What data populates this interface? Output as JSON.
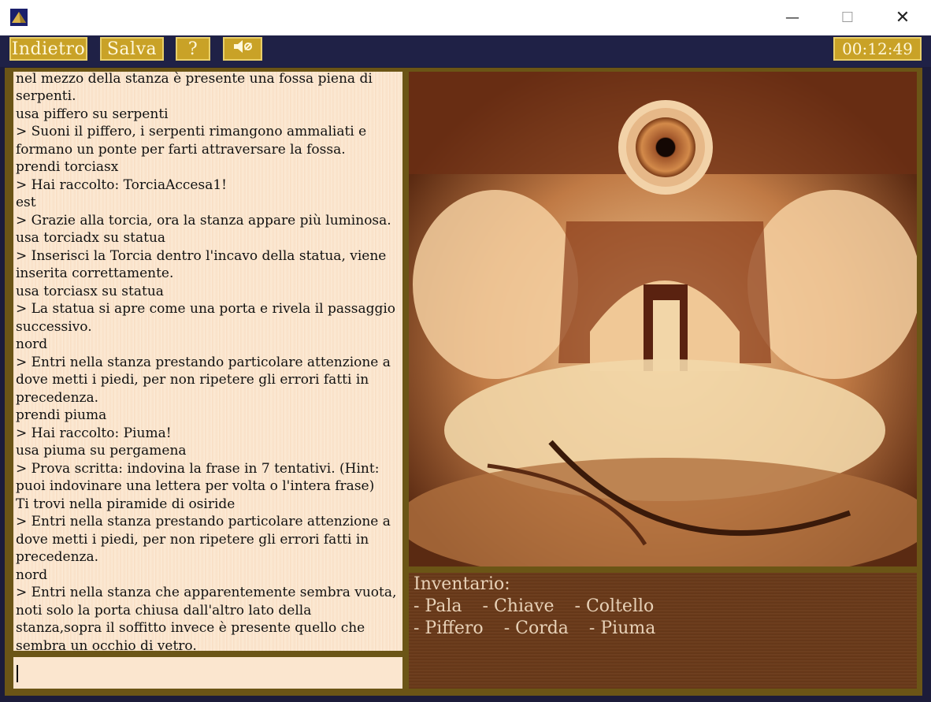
{
  "window": {
    "minimize_symbol": "—",
    "maximize_symbol": "☐",
    "close_symbol": "✕",
    "icon": "pyramid-icon"
  },
  "toolbar": {
    "back_label": "Indietro",
    "save_label": "Salva",
    "help_label": "?",
    "sound_icon": "speaker-muted-icon",
    "timer": "00:12:49"
  },
  "log": {
    "lines": [
      "nel mezzo della stanza è presente una fossa piena di serpenti.",
      "usa piffero su serpenti",
      "> Suoni il piffero, i serpenti rimangono ammaliati e formano un ponte per farti attraversare la fossa.",
      "prendi torciasx",
      "> Hai raccolto: TorciaAccesa1!",
      "est",
      "> Grazie alla torcia, ora la stanza appare più luminosa.",
      "usa torciadx su statua",
      "> Inserisci la Torcia dentro l'incavo della statua, viene inserita correttamente.",
      "usa torciasx su statua",
      "> La statua si apre come una porta e rivela il passaggio successivo.",
      "nord",
      "> Entri nella stanza prestando particolare attenzione a dove metti i piedi, per non ripetere gli errori fatti in precedenza.",
      "prendi piuma",
      "> Hai raccolto: Piuma!",
      "usa piuma su pergamena",
      "> Prova scritta: indovina la frase in 7 tentativi. (Hint: puoi indovinare una lettera per volta o l'intera frase)",
      "Ti trovi nella piramide di osiride",
      "> Entri nella stanza prestando particolare attenzione a dove metti i piedi, per non ripetere gli errori fatti in precedenza.",
      "nord",
      "> Entri nella stanza che apparentemente sembra vuota, noti solo la porta chiusa dall'altro lato della stanza,sopra il soffitto invece è presente quello che sembra un occhio di vetro."
    ]
  },
  "command_input": {
    "value": ""
  },
  "inventory": {
    "title": "Inventario:",
    "row1": [
      "- Pala",
      "- Chiave",
      "- Coltello"
    ],
    "row2": [
      "- Piffero",
      "- Corda",
      "- Piuma"
    ]
  },
  "colors": {
    "toolbar_button": "#c9a227",
    "frame": "#6b5516",
    "log_bg": "#fbe6cf",
    "inventory_bg": "#6a3a1a"
  }
}
